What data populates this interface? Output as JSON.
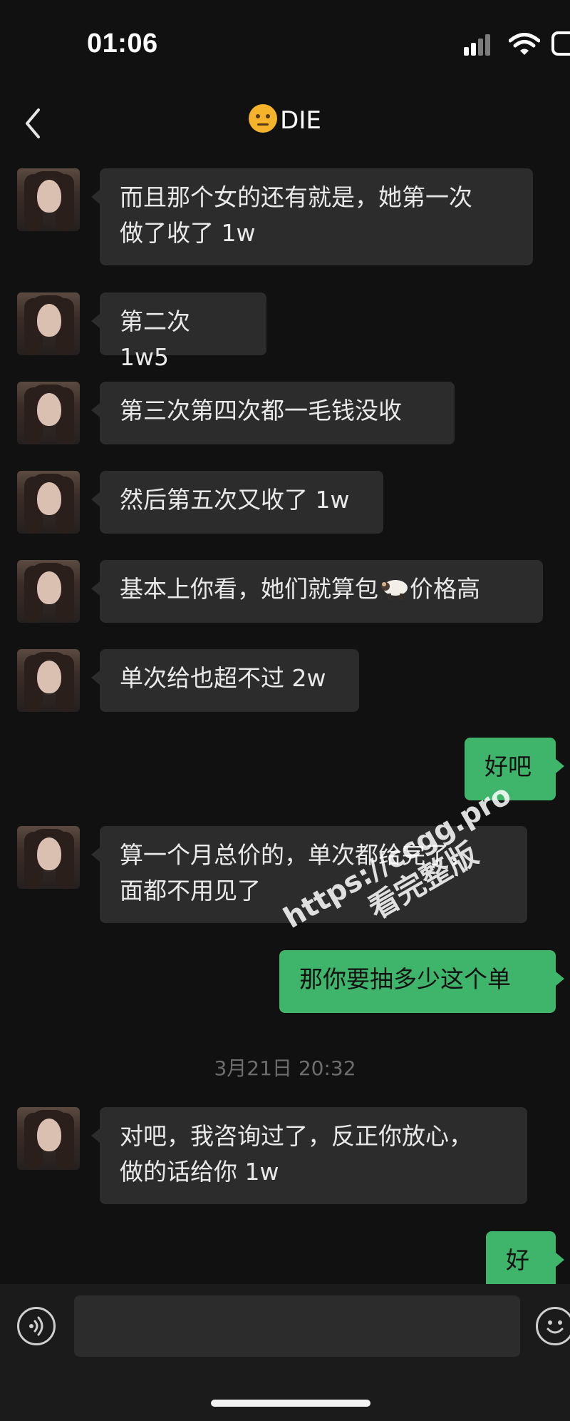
{
  "status_bar": {
    "time": "01:06"
  },
  "header": {
    "title": "DIE",
    "title_emoji": "face-with-raised-eyebrow"
  },
  "messages": [
    {
      "side": "in",
      "text": "而且那个女的还有就是，她第一次\n做了收了 1w"
    },
    {
      "side": "in",
      "text": "第二次 1w5"
    },
    {
      "side": "in",
      "text": "第三次第四次都一毛钱没收"
    },
    {
      "side": "in",
      "text": "然后第五次又收了 1w"
    },
    {
      "side": "in",
      "text_before": "基本上你看，她们就算包",
      "emoji": "sheep",
      "text_after": "价格高"
    },
    {
      "side": "in",
      "text": "单次给也超不过 2w"
    },
    {
      "side": "out",
      "text": "好吧"
    },
    {
      "side": "in",
      "text": "算一个月总价的，单次都给完了，\n面都不用见了"
    },
    {
      "side": "out",
      "text": "那你要抽多少这个单"
    },
    {
      "side": "in",
      "text": "对吧，我咨询过了，反正你放心，\n做的话给你 1w"
    },
    {
      "side": "out",
      "text": "好"
    }
  ],
  "timestamp": "3月21日 20:32",
  "watermark": {
    "line1": "https://ccgg.pro",
    "line2": "看完整版"
  },
  "colors": {
    "background": "#111111",
    "bubble_in": "#2c2c2c",
    "bubble_out": "#3eb56a"
  },
  "input": {
    "value": ""
  }
}
